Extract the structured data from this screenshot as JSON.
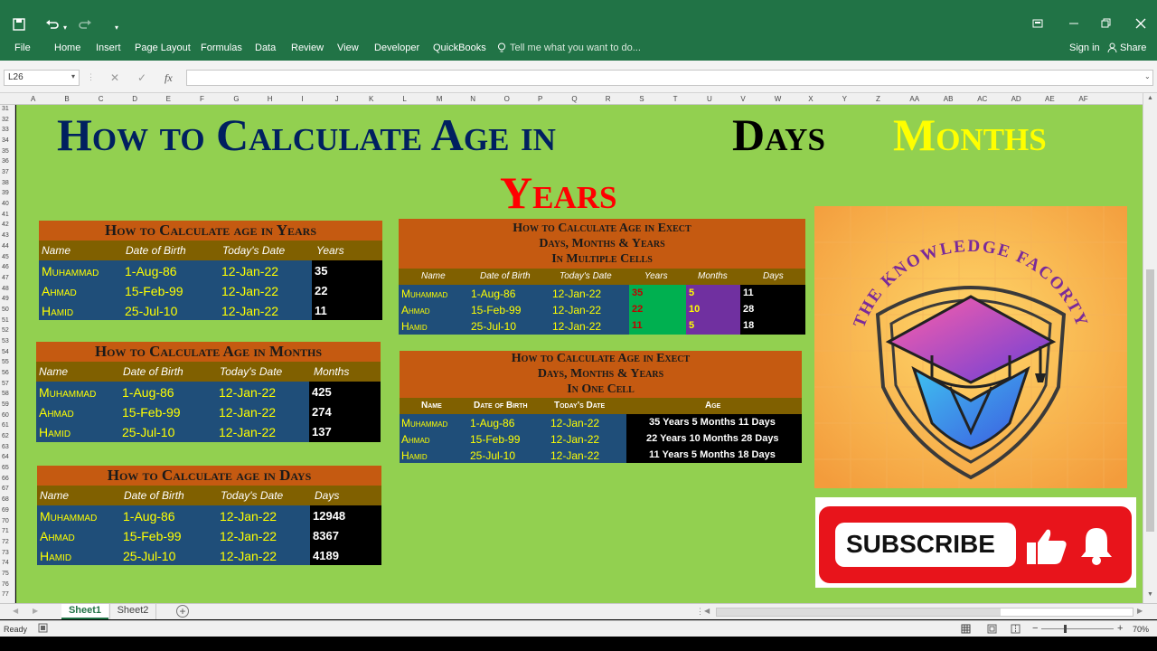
{
  "titlebar": {
    "save_icon": "save-icon",
    "undo_icon": "undo-icon",
    "redo_icon": "redo-icon",
    "window_controls": [
      "ribbon-display-icon",
      "minimize-icon",
      "restore-icon",
      "close-icon"
    ]
  },
  "ribbon": {
    "tabs": [
      "File",
      "Home",
      "Insert",
      "Page Layout",
      "Formulas",
      "Data",
      "Review",
      "View",
      "Developer",
      "QuickBooks"
    ],
    "tell_me": "Tell me what you want to do...",
    "sign_in": "Sign in",
    "share": "Share"
  },
  "formula_bar": {
    "name_box": "L26",
    "cancel_symbol": "✕",
    "enter_symbol": "✓",
    "fx_symbol": "fx",
    "value": ""
  },
  "columns": [
    "A",
    "B",
    "C",
    "D",
    "E",
    "F",
    "G",
    "H",
    "I",
    "J",
    "K",
    "L",
    "M",
    "N",
    "O",
    "P",
    "Q",
    "R",
    "S",
    "T",
    "U",
    "V",
    "W",
    "X",
    "Y",
    "Z",
    "AA",
    "AB",
    "AC",
    "AD",
    "AE",
    "AF"
  ],
  "rows": [
    "31",
    "32",
    "33",
    "34",
    "35",
    "36",
    "37",
    "38",
    "39",
    "40",
    "41",
    "42",
    "43",
    "44",
    "45",
    "46",
    "47",
    "48",
    "49",
    "50",
    "51",
    "52",
    "53",
    "54",
    "55",
    "56",
    "57",
    "58",
    "59",
    "60",
    "61",
    "62",
    "63",
    "64",
    "65",
    "66",
    "67",
    "68",
    "69",
    "70",
    "71",
    "72",
    "73",
    "74",
    "75",
    "76",
    "77"
  ],
  "heading": {
    "line1_part1": "How to Calculate Age in",
    "line1_days": "Days",
    "line1_months": "Months",
    "line2_years": "Years",
    "color_blue": "#002060",
    "color_black": "#000000",
    "color_yellow": "#ffff00",
    "color_red": "#ff0000"
  },
  "table_years": {
    "title": "How to Calculate age in Years",
    "headers": [
      "Name",
      "Date of Birth",
      "Today's Date",
      "Years"
    ],
    "rows": [
      [
        "Muhammad",
        "1-Aug-86",
        "12-Jan-22",
        "35"
      ],
      [
        "Ahmad",
        "15-Feb-99",
        "12-Jan-22",
        "22"
      ],
      [
        "Hamid",
        "25-Jul-10",
        "12-Jan-22",
        "11"
      ]
    ]
  },
  "table_months": {
    "title": "How to Calculate Age in Months",
    "headers": [
      "Name",
      "Date of Birth",
      "Today's Date",
      "Months"
    ],
    "rows": [
      [
        "Muhammad",
        "1-Aug-86",
        "12-Jan-22",
        "425"
      ],
      [
        "Ahmad",
        "15-Feb-99",
        "12-Jan-22",
        "274"
      ],
      [
        "Hamid",
        "25-Jul-10",
        "12-Jan-22",
        "137"
      ]
    ]
  },
  "table_days": {
    "title": "How to Calculate age in Days",
    "headers": [
      "Name",
      "Date of Birth",
      "Today's Date",
      "Days"
    ],
    "rows": [
      [
        "Muhammad",
        "1-Aug-86",
        "12-Jan-22",
        "12948"
      ],
      [
        "Ahmad",
        "15-Feb-99",
        "12-Jan-22",
        "8367"
      ],
      [
        "Hamid",
        "25-Jul-10",
        "12-Jan-22",
        "4189"
      ]
    ]
  },
  "table_multi": {
    "title_lines": [
      "How to Calculate Age in Exect",
      "Days, Months & Years",
      "In Multiple Cells"
    ],
    "headers": [
      "Name",
      "Date of Birth",
      "Today's Date",
      "Years",
      "Months",
      "Days"
    ],
    "rows": [
      [
        "Muhammad",
        "1-Aug-86",
        "12-Jan-22",
        "35",
        "5",
        "11"
      ],
      [
        "Ahmad",
        "15-Feb-99",
        "12-Jan-22",
        "22",
        "10",
        "28"
      ],
      [
        "Hamid",
        "25-Jul-10",
        "12-Jan-22",
        "11",
        "5",
        "18"
      ]
    ]
  },
  "table_single": {
    "title_lines": [
      "How to Calculate Age in Exect",
      "Days, Months & Years",
      "In One Cell"
    ],
    "headers": [
      "Name",
      "Date of Birth",
      "Today's Date",
      "Age"
    ],
    "rows": [
      [
        "Muhammad",
        "1-Aug-86",
        "12-Jan-22",
        "35 Years 5 Months 11 Days"
      ],
      [
        "Ahmad",
        "15-Feb-99",
        "12-Jan-22",
        "22 Years 10 Months 28 Days"
      ],
      [
        "Hamid",
        "25-Jul-10",
        "12-Jan-22",
        "11 Years 5 Months 18 Days"
      ]
    ]
  },
  "logo": {
    "text": "THE KNOWLEDGE FACORTY",
    "icon": "graduation-cap-shield-logo"
  },
  "subscribe": {
    "label": "SUBSCRIBE",
    "thumb_icon": "thumbs-up-icon",
    "bell_icon": "bell-icon"
  },
  "sheet_tabs": [
    "Sheet1",
    "Sheet2"
  ],
  "status": {
    "ready": "Ready",
    "zoom": "70%"
  }
}
